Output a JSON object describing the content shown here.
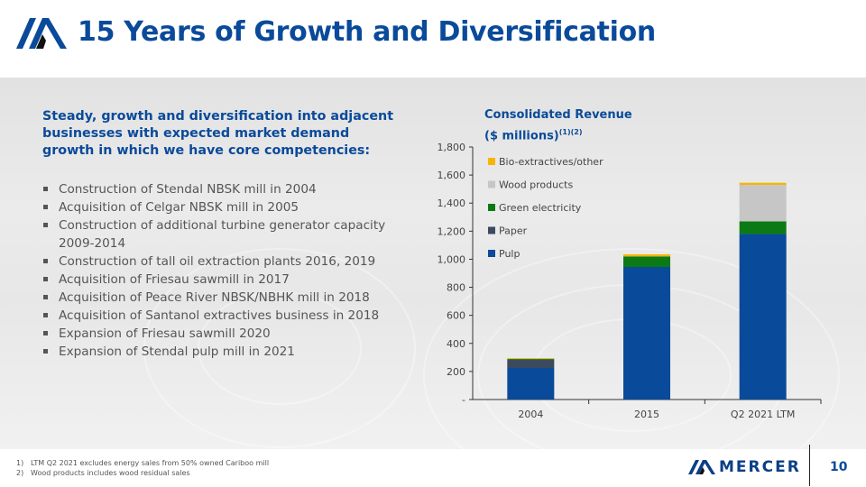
{
  "slide": {
    "title": "15 Years of Growth and Diversification",
    "intro": "Steady, growth and diversification into adjacent businesses with expected market demand growth in which we have core competencies:",
    "bullets": [
      "Construction of Stendal NBSK mill in 2004",
      "Acquisition of Celgar NBSK mill in 2005",
      "Construction of additional turbine generator capacity 2009-2014",
      "Construction of tall oil extraction plants 2016, 2019",
      "Acquisition of Friesau sawmill in 2017",
      "Acquisition of Peace River NBSK/NBHK mill in 2018",
      "Acquisition of Santanol extractives business in 2018",
      "Expansion of Friesau sawmill 2020",
      "Expansion of Stendal pulp mill in 2021"
    ],
    "chart_title_line1": "Consolidated Revenue",
    "chart_title_line2": "($ millions)",
    "chart_title_sup": "(1)(2)"
  },
  "footer": {
    "notes": [
      {
        "num": "1)",
        "text": "LTM Q2 2021 excludes energy sales from 50% owned Cariboo mill"
      },
      {
        "num": "2)",
        "text": "Wood products includes wood residual sales"
      }
    ],
    "brand": "MERCER",
    "page_number": "10"
  },
  "colors": {
    "brand_blue": "#0a4a9a",
    "pulp": "#0a4a9a",
    "paper": "#3b4a5e",
    "green_electricity": "#0c7a14",
    "wood_products": "#c6c6c6",
    "bio_extractives": "#f7b500"
  },
  "chart_data": {
    "type": "bar",
    "stacked": true,
    "categories": [
      "2004",
      "2015",
      "Q2 2021 LTM"
    ],
    "series": [
      {
        "name": "Pulp",
        "values": [
          225,
          945,
          1180
        ],
        "color": "#0a4a9a"
      },
      {
        "name": "Paper",
        "values": [
          60,
          0,
          0
        ],
        "color": "#3b4a5e"
      },
      {
        "name": "Green electricity",
        "values": [
          5,
          75,
          90
        ],
        "color": "#0c7a14"
      },
      {
        "name": "Wood products",
        "values": [
          0,
          0,
          260
        ],
        "color": "#c6c6c6"
      },
      {
        "name": "Bio-extractives/other",
        "values": [
          5,
          15,
          15
        ],
        "color": "#f7b500"
      }
    ],
    "legend_order": [
      "Bio-extractives/other",
      "Wood products",
      "Green electricity",
      "Paper",
      "Pulp"
    ],
    "legend_position": "top-left",
    "yticks": [
      "-",
      "200",
      "400",
      "600",
      "800",
      "1,000",
      "1,200",
      "1,400",
      "1,600",
      "1,800"
    ],
    "ylim": [
      0,
      1800
    ],
    "grid": false
  }
}
